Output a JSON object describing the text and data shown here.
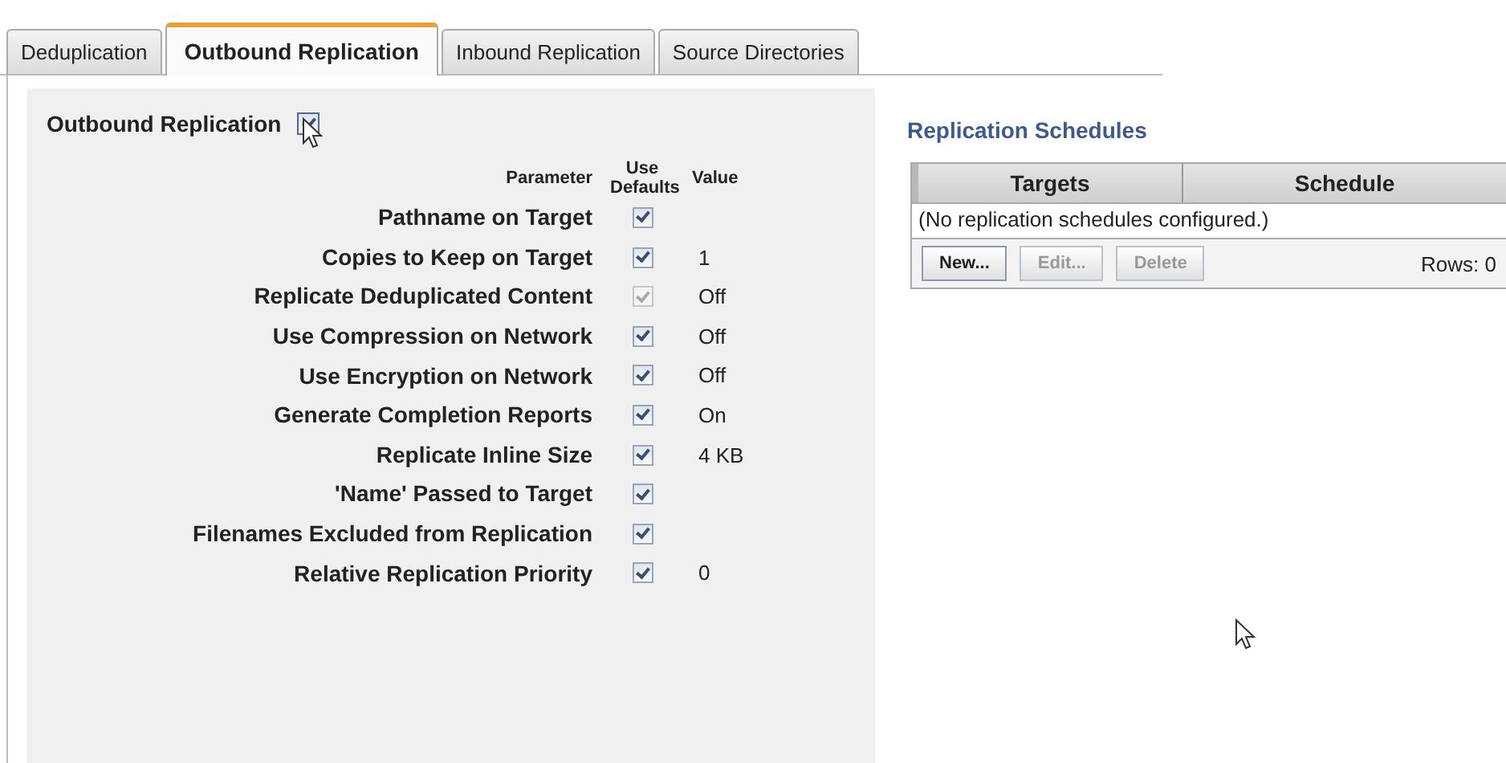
{
  "tabs": [
    {
      "label": "Deduplication",
      "selected": false
    },
    {
      "label": "Outbound Replication",
      "selected": true
    },
    {
      "label": "Inbound Replication",
      "selected": false
    },
    {
      "label": "Source Directories",
      "selected": false
    }
  ],
  "outbound": {
    "label": "Outbound Replication",
    "checked": true
  },
  "parameters": {
    "columns": [
      "Parameter",
      "Use Defaults",
      "Value"
    ],
    "rows": [
      {
        "name": "Pathname on Target",
        "use_defaults": true,
        "disabled": false,
        "value": ""
      },
      {
        "name": "Copies to Keep on Target",
        "use_defaults": true,
        "disabled": false,
        "value": "1"
      },
      {
        "name": "Replicate Deduplicated Content",
        "use_defaults": true,
        "disabled": true,
        "value": "Off"
      },
      {
        "name": "Use Compression on Network",
        "use_defaults": true,
        "disabled": false,
        "value": "Off"
      },
      {
        "name": "Use Encryption on Network",
        "use_defaults": true,
        "disabled": false,
        "value": "Off"
      },
      {
        "name": "Generate Completion Reports",
        "use_defaults": true,
        "disabled": false,
        "value": "On"
      },
      {
        "name": "Replicate Inline Size",
        "use_defaults": true,
        "disabled": false,
        "value": "4 KB"
      },
      {
        "name": "'Name' Passed to Target",
        "use_defaults": true,
        "disabled": false,
        "value": ""
      },
      {
        "name": "Filenames Excluded from Replication",
        "use_defaults": true,
        "disabled": false,
        "value": ""
      },
      {
        "name": "Relative Replication Priority",
        "use_defaults": true,
        "disabled": false,
        "value": "0"
      }
    ]
  },
  "schedules": {
    "title": "Replication Schedules",
    "columns": [
      "Targets",
      "Schedule"
    ],
    "empty_message": "(No replication schedules configured.)",
    "buttons": [
      {
        "label": "New...",
        "disabled": false
      },
      {
        "label": "Edit...",
        "disabled": true
      },
      {
        "label": "Delete",
        "disabled": true
      }
    ],
    "rows_count": "Rows: 0"
  }
}
